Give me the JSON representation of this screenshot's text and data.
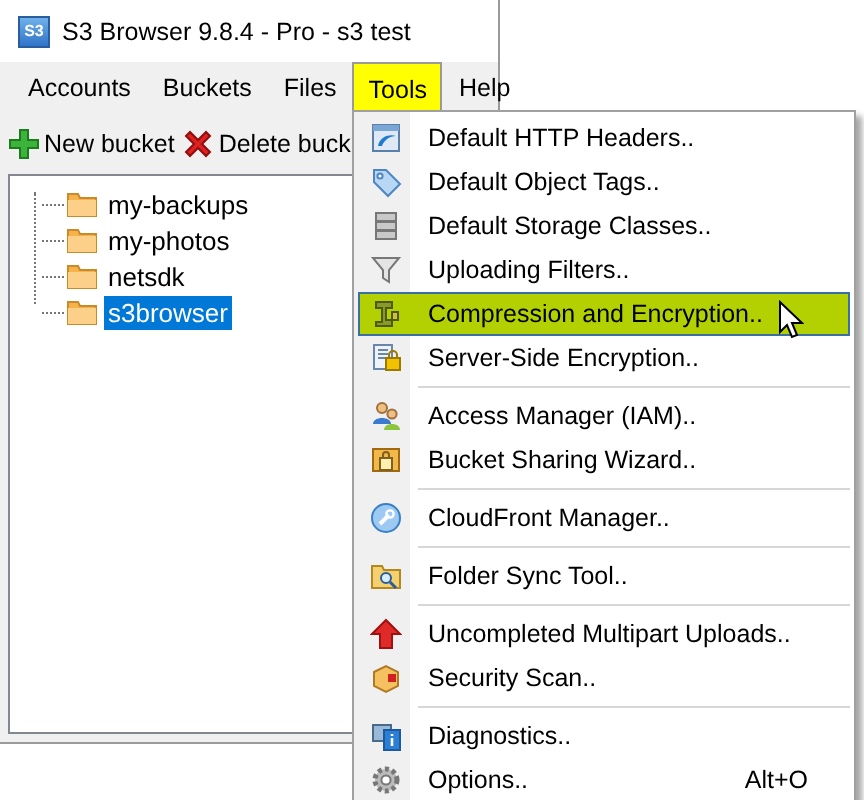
{
  "window": {
    "title": "S3 Browser 9.8.4 - Pro - s3 test",
    "app_icon_text": "S3"
  },
  "menu_bar": [
    {
      "label": "Accounts",
      "selected": false
    },
    {
      "label": "Buckets",
      "selected": false
    },
    {
      "label": "Files",
      "selected": false
    },
    {
      "label": "Tools",
      "selected": true
    },
    {
      "label": "Help",
      "selected": false
    }
  ],
  "toolbar": [
    {
      "label": "New bucket",
      "kind": "add"
    },
    {
      "label": "Delete buck",
      "kind": "delete"
    }
  ],
  "tree": [
    {
      "label": "my-backups",
      "selected": false
    },
    {
      "label": "my-photos",
      "selected": false
    },
    {
      "label": "netsdk",
      "selected": false
    },
    {
      "label": "s3browser",
      "selected": true
    }
  ],
  "tools_menu": [
    {
      "kind": "item",
      "label": "Default HTTP Headers..",
      "selected": false
    },
    {
      "kind": "item",
      "label": "Default Object Tags..",
      "selected": false
    },
    {
      "kind": "item",
      "label": "Default Storage Classes..",
      "selected": false
    },
    {
      "kind": "item",
      "label": "Uploading Filters..",
      "selected": false
    },
    {
      "kind": "item",
      "label": "Compression and Encryption..",
      "selected": true
    },
    {
      "kind": "item",
      "label": "Server-Side Encryption..",
      "selected": false
    },
    {
      "kind": "separator"
    },
    {
      "kind": "item",
      "label": "Access Manager (IAM)..",
      "selected": false
    },
    {
      "kind": "item",
      "label": "Bucket Sharing Wizard..",
      "selected": false
    },
    {
      "kind": "separator"
    },
    {
      "kind": "item",
      "label": "CloudFront Manager..",
      "selected": false
    },
    {
      "kind": "separator"
    },
    {
      "kind": "item",
      "label": "Folder Sync Tool..",
      "selected": false
    },
    {
      "kind": "separator"
    },
    {
      "kind": "item",
      "label": "Uncompleted Multipart Uploads..",
      "selected": false
    },
    {
      "kind": "item",
      "label": "Security Scan..",
      "selected": false
    },
    {
      "kind": "separator"
    },
    {
      "kind": "item",
      "label": "Diagnostics..",
      "selected": false
    },
    {
      "kind": "item",
      "label": "Options..",
      "selected": false,
      "shortcut": "Alt+O"
    }
  ]
}
